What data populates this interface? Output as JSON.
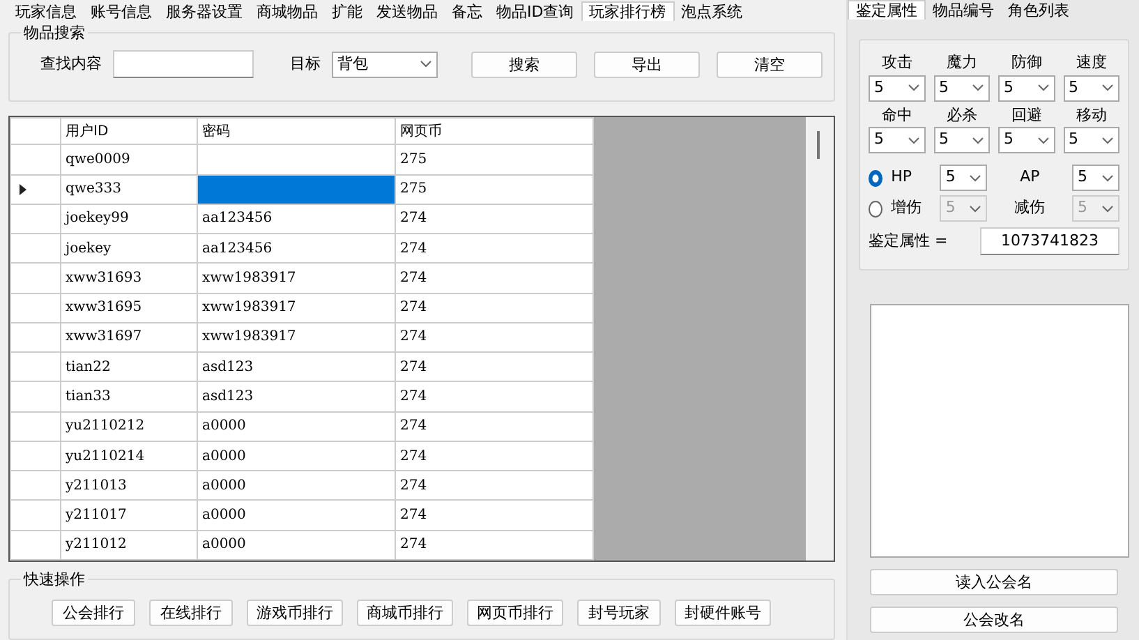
{
  "main_tabs": [
    {
      "label": "玩家信息",
      "selected": false
    },
    {
      "label": "账号信息",
      "selected": false
    },
    {
      "label": "服务器设置",
      "selected": false
    },
    {
      "label": "商城物品",
      "selected": false
    },
    {
      "label": "扩能",
      "selected": false
    },
    {
      "label": "发送物品",
      "selected": false
    },
    {
      "label": "备忘",
      "selected": false
    },
    {
      "label": "物品ID查询",
      "selected": false
    },
    {
      "label": "玩家排行榜",
      "selected": true
    },
    {
      "label": "泡点系统",
      "selected": false
    }
  ],
  "search_group": {
    "title": "物品搜索",
    "query_label": "查找内容",
    "target_label": "目标",
    "target_value": "背包",
    "buttons": [
      "搜索",
      "导出",
      "清空"
    ]
  },
  "table": {
    "columns": [
      "用户ID",
      "密码",
      "网页币"
    ],
    "rows": [
      {
        "current": false,
        "cells": [
          {
            "text": "qwe0009",
            "selected": false
          },
          {
            "selected": false
          },
          {
            "text": "275",
            "selected": false
          }
        ]
      },
      {
        "current": true,
        "cells": [
          {
            "text": "qwe333",
            "selected": false
          },
          {
            "selected": true
          },
          {
            "text": "275",
            "selected": false
          }
        ]
      },
      {
        "current": false,
        "cells": [
          {
            "text": "joekey99",
            "selected": false
          },
          {
            "text": "aa123456",
            "selected": false
          },
          {
            "text": "274",
            "selected": false
          }
        ]
      },
      {
        "current": false,
        "cells": [
          {
            "text": "joekey",
            "selected": false
          },
          {
            "text": "aa123456",
            "selected": false
          },
          {
            "text": "274",
            "selected": false
          }
        ]
      },
      {
        "current": false,
        "cells": [
          {
            "text": "xww31693",
            "selected": false
          },
          {
            "text": "xww1983917",
            "selected": false
          },
          {
            "text": "274",
            "selected": false
          }
        ]
      },
      {
        "current": false,
        "cells": [
          {
            "text": "xww31695",
            "selected": false
          },
          {
            "text": "xww1983917",
            "selected": false
          },
          {
            "text": "274",
            "selected": false
          }
        ]
      },
      {
        "current": false,
        "cells": [
          {
            "text": "xww31697",
            "selected": false
          },
          {
            "text": "xww1983917",
            "selected": false
          },
          {
            "text": "274",
            "selected": false
          }
        ]
      },
      {
        "current": false,
        "cells": [
          {
            "text": "tian22",
            "selected": false
          },
          {
            "text": "asd123",
            "selected": false
          },
          {
            "text": "274",
            "selected": false
          }
        ]
      },
      {
        "current": false,
        "cells": [
          {
            "text": "tian33",
            "selected": false
          },
          {
            "text": "asd123",
            "selected": false
          },
          {
            "text": "274",
            "selected": false
          }
        ]
      },
      {
        "current": false,
        "cells": [
          {
            "text": "yu2110212",
            "selected": false
          },
          {
            "text": "a0000",
            "selected": false
          },
          {
            "text": "274",
            "selected": false
          }
        ]
      },
      {
        "current": false,
        "cells": [
          {
            "text": "yu2110214",
            "selected": false
          },
          {
            "text": "a0000",
            "selected": false
          },
          {
            "text": "274",
            "selected": false
          }
        ]
      },
      {
        "current": false,
        "cells": [
          {
            "text": "y211013",
            "selected": false
          },
          {
            "text": "a0000",
            "selected": false
          },
          {
            "text": "274",
            "selected": false
          }
        ]
      },
      {
        "current": false,
        "cells": [
          {
            "text": "y211017",
            "selected": false
          },
          {
            "text": "a0000",
            "selected": false
          },
          {
            "text": "274",
            "selected": false
          }
        ]
      },
      {
        "current": false,
        "cells": [
          {
            "text": "y211012",
            "selected": false
          },
          {
            "text": "a0000",
            "selected": false
          },
          {
            "text": "274",
            "selected": false
          }
        ]
      }
    ]
  },
  "quick_group": {
    "title": "快速操作",
    "buttons": [
      "公会排行",
      "在线排行",
      "游戏币排行",
      "商城币排行",
      "网页币排行",
      "封号玩家",
      "封硬件账号"
    ]
  },
  "side_tabs": [
    {
      "label": "鉴定属性",
      "selected": true
    },
    {
      "label": "物品编号",
      "selected": false
    },
    {
      "label": "角色列表",
      "selected": false
    }
  ],
  "attributes": [
    {
      "label": "攻击",
      "value": "5"
    },
    {
      "label": "魔力",
      "value": "5"
    },
    {
      "label": "防御",
      "value": "5"
    },
    {
      "label": "速度",
      "value": "5"
    },
    {
      "label": "命中",
      "value": "5"
    },
    {
      "label": "必杀",
      "value": "5"
    },
    {
      "label": "回避",
      "value": "5"
    },
    {
      "label": "移动",
      "value": "5"
    }
  ],
  "options": [
    {
      "radio_label": "HP",
      "selected": true,
      "value": "5",
      "disabled": false,
      "side_label": "AP",
      "side_value": "5",
      "side_disabled": false
    },
    {
      "radio_label": "增伤",
      "selected": false,
      "value": "5",
      "disabled": true,
      "side_label": "减伤",
      "side_value": "5",
      "side_disabled": true
    }
  ],
  "result": {
    "label": "鉴定属性 =",
    "value": "1073741823"
  },
  "side_buttons": [
    "读入公会名",
    "公会改名"
  ]
}
